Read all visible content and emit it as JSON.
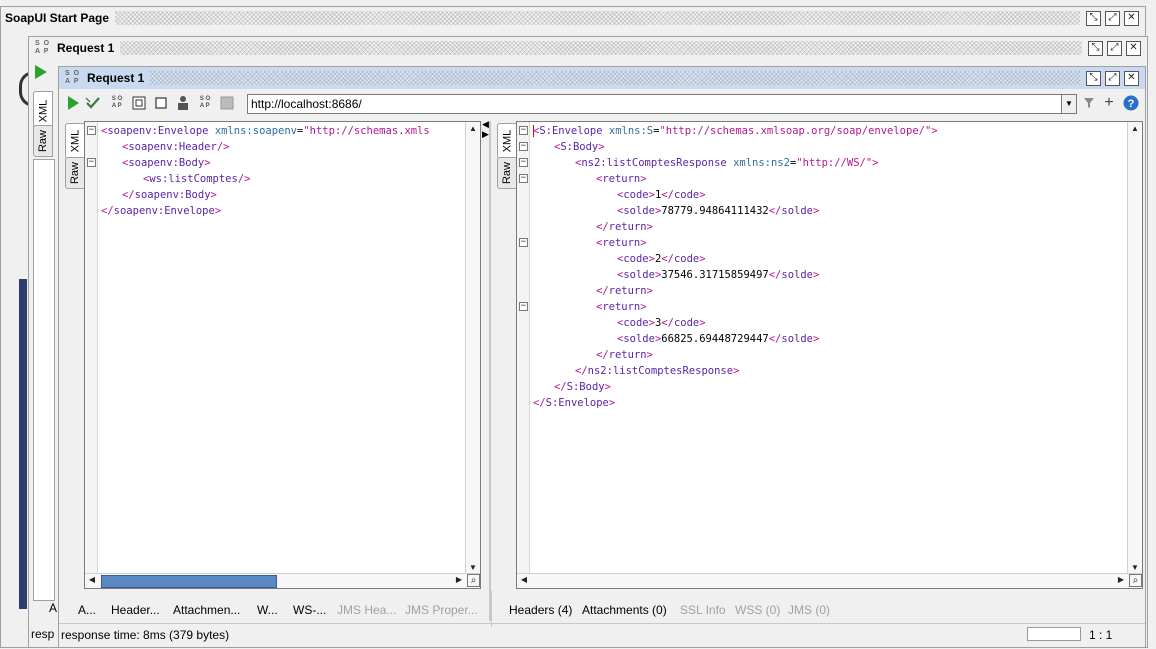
{
  "windows": {
    "start_page_title": "SoapUI Start Page",
    "request_outer_title": "Request 1",
    "request_inner_title": "Request 1",
    "soap_logo": "SO AP"
  },
  "toolbar": {
    "endpoint_url": "http://localhost:8686/"
  },
  "tabs": {
    "xml": "XML",
    "raw": "Raw"
  },
  "request_xml": [
    {
      "parts": [
        [
          "br",
          "<"
        ],
        [
          "tag",
          "soapenv:Envelope"
        ],
        [
          "txt",
          " "
        ],
        [
          "att",
          "xmlns:soapenv"
        ],
        [
          "txt",
          "="
        ],
        [
          "val",
          "\"http://schemas.xmls"
        ]
      ]
    },
    {
      "parts": [
        [
          "br",
          "<"
        ],
        [
          "tag",
          "soapenv:Header"
        ],
        [
          "br",
          "/>"
        ]
      ]
    },
    {
      "parts": [
        [
          "br",
          "<"
        ],
        [
          "tag",
          "soapenv:Body"
        ],
        [
          "br",
          ">"
        ]
      ]
    },
    {
      "parts": [
        [
          "br",
          "<"
        ],
        [
          "tag",
          "ws:listComptes"
        ],
        [
          "br",
          "/>"
        ]
      ]
    },
    {
      "parts": [
        [
          "br",
          "</"
        ],
        [
          "tag",
          "soapenv:Body"
        ],
        [
          "br",
          ">"
        ]
      ]
    },
    {
      "parts": [
        [
          "br",
          "</"
        ],
        [
          "tag",
          "soapenv:Envelope"
        ],
        [
          "br",
          ">"
        ]
      ]
    }
  ],
  "response_xml": [
    {
      "parts": [
        [
          "br",
          "<"
        ],
        [
          "tag",
          "S:Envelope"
        ],
        [
          "txt",
          " "
        ],
        [
          "att",
          "xmlns:S"
        ],
        [
          "txt",
          "="
        ],
        [
          "val",
          "\"http://schemas.xmlsoap.org/soap/envelope/\""
        ],
        [
          "br",
          ">"
        ]
      ]
    },
    {
      "parts": [
        [
          "br",
          "<"
        ],
        [
          "tag",
          "S:Body"
        ],
        [
          "br",
          ">"
        ]
      ]
    },
    {
      "parts": [
        [
          "br",
          "<"
        ],
        [
          "tag",
          "ns2:listComptesResponse"
        ],
        [
          "txt",
          " "
        ],
        [
          "att",
          "xmlns:ns2"
        ],
        [
          "txt",
          "="
        ],
        [
          "val",
          "\"http://WS/\""
        ],
        [
          "br",
          ">"
        ]
      ]
    },
    {
      "parts": [
        [
          "br",
          "<"
        ],
        [
          "tag",
          "return"
        ],
        [
          "br",
          ">"
        ]
      ]
    },
    {
      "parts": [
        [
          "br",
          "<"
        ],
        [
          "tag",
          "code"
        ],
        [
          "br",
          ">"
        ],
        [
          "txt",
          "1"
        ],
        [
          "br",
          "</"
        ],
        [
          "tag",
          "code"
        ],
        [
          "br",
          ">"
        ]
      ]
    },
    {
      "parts": [
        [
          "br",
          "<"
        ],
        [
          "tag",
          "solde"
        ],
        [
          "br",
          ">"
        ],
        [
          "txt",
          "78779.94864111432"
        ],
        [
          "br",
          "</"
        ],
        [
          "tag",
          "solde"
        ],
        [
          "br",
          ">"
        ]
      ]
    },
    {
      "parts": [
        [
          "br",
          "</"
        ],
        [
          "tag",
          "return"
        ],
        [
          "br",
          ">"
        ]
      ]
    },
    {
      "parts": [
        [
          "br",
          "<"
        ],
        [
          "tag",
          "return"
        ],
        [
          "br",
          ">"
        ]
      ]
    },
    {
      "parts": [
        [
          "br",
          "<"
        ],
        [
          "tag",
          "code"
        ],
        [
          "br",
          ">"
        ],
        [
          "txt",
          "2"
        ],
        [
          "br",
          "</"
        ],
        [
          "tag",
          "code"
        ],
        [
          "br",
          ">"
        ]
      ]
    },
    {
      "parts": [
        [
          "br",
          "<"
        ],
        [
          "tag",
          "solde"
        ],
        [
          "br",
          ">"
        ],
        [
          "txt",
          "37546.31715859497"
        ],
        [
          "br",
          "</"
        ],
        [
          "tag",
          "solde"
        ],
        [
          "br",
          ">"
        ]
      ]
    },
    {
      "parts": [
        [
          "br",
          "</"
        ],
        [
          "tag",
          "return"
        ],
        [
          "br",
          ">"
        ]
      ]
    },
    {
      "parts": [
        [
          "br",
          "<"
        ],
        [
          "tag",
          "return"
        ],
        [
          "br",
          ">"
        ]
      ]
    },
    {
      "parts": [
        [
          "br",
          "<"
        ],
        [
          "tag",
          "code"
        ],
        [
          "br",
          ">"
        ],
        [
          "txt",
          "3"
        ],
        [
          "br",
          "</"
        ],
        [
          "tag",
          "code"
        ],
        [
          "br",
          ">"
        ]
      ]
    },
    {
      "parts": [
        [
          "br",
          "<"
        ],
        [
          "tag",
          "solde"
        ],
        [
          "br",
          ">"
        ],
        [
          "txt",
          "66825.69448729447"
        ],
        [
          "br",
          "</"
        ],
        [
          "tag",
          "solde"
        ],
        [
          "br",
          ">"
        ]
      ]
    },
    {
      "parts": [
        [
          "br",
          "</"
        ],
        [
          "tag",
          "return"
        ],
        [
          "br",
          ">"
        ]
      ]
    },
    {
      "parts": [
        [
          "br",
          "</"
        ],
        [
          "tag",
          "ns2:listComptesResponse"
        ],
        [
          "br",
          ">"
        ]
      ]
    },
    {
      "parts": [
        [
          "br",
          "</"
        ],
        [
          "tag",
          "S:Body"
        ],
        [
          "br",
          ">"
        ]
      ]
    },
    {
      "parts": [
        [
          "br",
          "</"
        ],
        [
          "tag",
          "S:Envelope"
        ],
        [
          "br",
          ">"
        ]
      ]
    }
  ],
  "request_tabs": [
    "A...",
    "Header...",
    "Attachmen...",
    "W...",
    "WS-...",
    "JMS Hea...",
    "JMS Proper..."
  ],
  "response_tabs": [
    "Headers (4)",
    "Attachments (0)",
    "SSL Info",
    "WSS (0)",
    "JMS (0)"
  ],
  "status": {
    "response_time": "response time: 8ms (379 bytes)",
    "cursor_pos": "1 : 1",
    "bg_tab_label": "A",
    "bg_status": "resp"
  },
  "colors": {
    "tag": "#5a1faa",
    "bracket": "#b2188f",
    "attribute": "#2e6da0",
    "run_green": "#2da12d"
  }
}
